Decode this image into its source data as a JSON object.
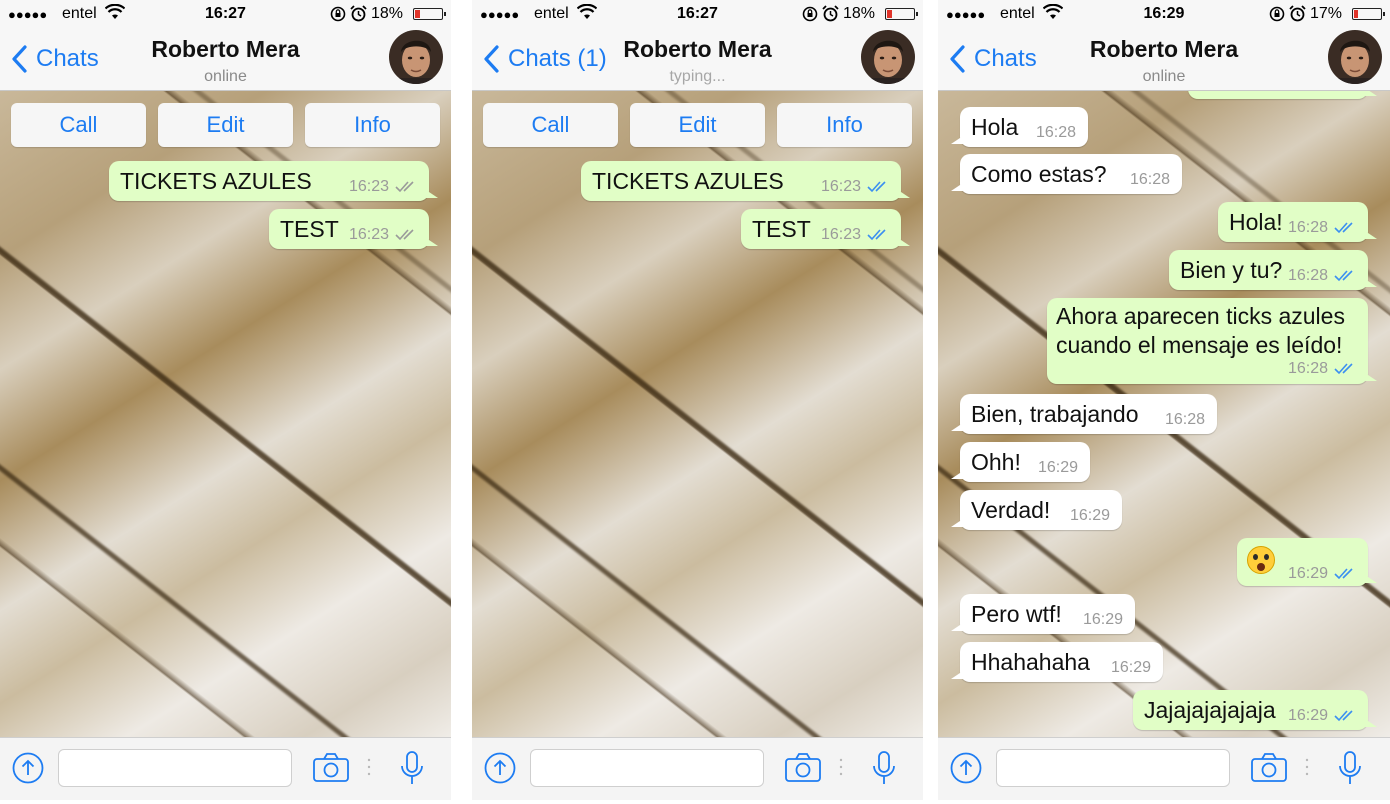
{
  "statusbar": {
    "carrier": "entel",
    "signal_dots": "●●●●●",
    "colors": {
      "battery_low": "#e0342a"
    }
  },
  "ui": {
    "accent": "#1d7cf2",
    "outgoing_bubble": "#e1fec6",
    "incoming_bubble": "#ffffff",
    "read_ticks": "#3b8ff1",
    "delivered_ticks": "#9a9a9a"
  },
  "icons": [
    "signal-dots-icon",
    "wifi-icon",
    "orientation-lock-icon",
    "alarm-icon",
    "battery-icon",
    "back-chevron-icon",
    "upload-icon",
    "camera-icon",
    "microphone-icon",
    "double-check-icon"
  ],
  "screens": [
    {
      "time": "16:27",
      "battery": "18%",
      "battery_level": 0.18,
      "back_label": "Chats",
      "contact_name": "Roberto Mera",
      "contact_status": "online",
      "actions": [
        "Call",
        "Edit",
        "Info"
      ],
      "messages": [
        {
          "text": "TICKETS AZULES",
          "time": "16:23",
          "dir": "out",
          "ticks": "delivered"
        },
        {
          "text": "TEST",
          "time": "16:23",
          "dir": "out",
          "ticks": "delivered"
        }
      ]
    },
    {
      "time": "16:27",
      "battery": "18%",
      "battery_level": 0.18,
      "back_label": "Chats (1)",
      "contact_name": "Roberto Mera",
      "contact_status": "typing...",
      "actions": [
        "Call",
        "Edit",
        "Info"
      ],
      "messages": [
        {
          "text": "TICKETS AZULES",
          "time": "16:23",
          "dir": "out",
          "ticks": "read"
        },
        {
          "text": "TEST",
          "time": "16:23",
          "dir": "out",
          "ticks": "read"
        }
      ]
    },
    {
      "time": "16:29",
      "battery": "17%",
      "battery_level": 0.17,
      "back_label": "Chats",
      "contact_name": "Roberto Mera",
      "contact_status": "online",
      "messages": [
        {
          "text": "Hola",
          "time": "16:28",
          "dir": "in"
        },
        {
          "text": "Como estas?",
          "time": "16:28",
          "dir": "in"
        },
        {
          "text": "Hola!",
          "time": "16:28",
          "dir": "out",
          "ticks": "read"
        },
        {
          "text": "Bien y tu?",
          "time": "16:28",
          "dir": "out",
          "ticks": "read"
        },
        {
          "text": "Ahora aparecen ticks azules cuando el mensaje es leído!",
          "time": "16:28",
          "dir": "out",
          "ticks": "read"
        },
        {
          "text": "Bien, trabajando",
          "time": "16:28",
          "dir": "in"
        },
        {
          "text": "Ohh!",
          "time": "16:29",
          "dir": "in"
        },
        {
          "text": "Verdad!",
          "time": "16:29",
          "dir": "in"
        },
        {
          "text": "",
          "emoji": "face-screaming-in-fear",
          "time": "16:29",
          "dir": "out",
          "ticks": "read"
        },
        {
          "text": "Pero wtf!",
          "time": "16:29",
          "dir": "in"
        },
        {
          "text": "Hhahahaha",
          "time": "16:29",
          "dir": "in"
        },
        {
          "text": "Jajajajajajaja",
          "time": "16:29",
          "dir": "out",
          "ticks": "read"
        }
      ]
    }
  ]
}
